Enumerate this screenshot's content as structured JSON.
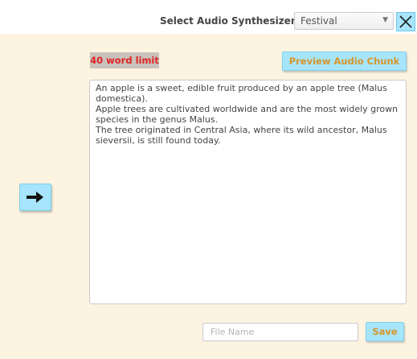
{
  "header": {
    "synth_label": "Select Audio Synthesizer:",
    "synth_selected": "Festival",
    "close_icon": "close-x-icon"
  },
  "editor": {
    "word_limit_label": "40 word limit",
    "preview_label": "Preview Audio Chunk",
    "text": "An apple is a sweet, edible fruit produced by an apple tree (Malus domestica).\nApple trees are cultivated worldwide and are the most widely grown species in the genus Malus.\nThe tree originated in Central Asia, where its wild ancestor, Malus sieversii, is still found today."
  },
  "sidebar": {
    "arrow_icon": "arrow-right-icon"
  },
  "footer": {
    "file_name_value": "",
    "file_name_placeholder": "File Name",
    "save_label": "Save"
  },
  "colors": {
    "panel_background": "#fdf3e1",
    "button_background": "#a6e5fb",
    "button_text": "#d5962a",
    "word_limit_text": "#e02323",
    "word_limit_background": "#c9c1bb"
  }
}
